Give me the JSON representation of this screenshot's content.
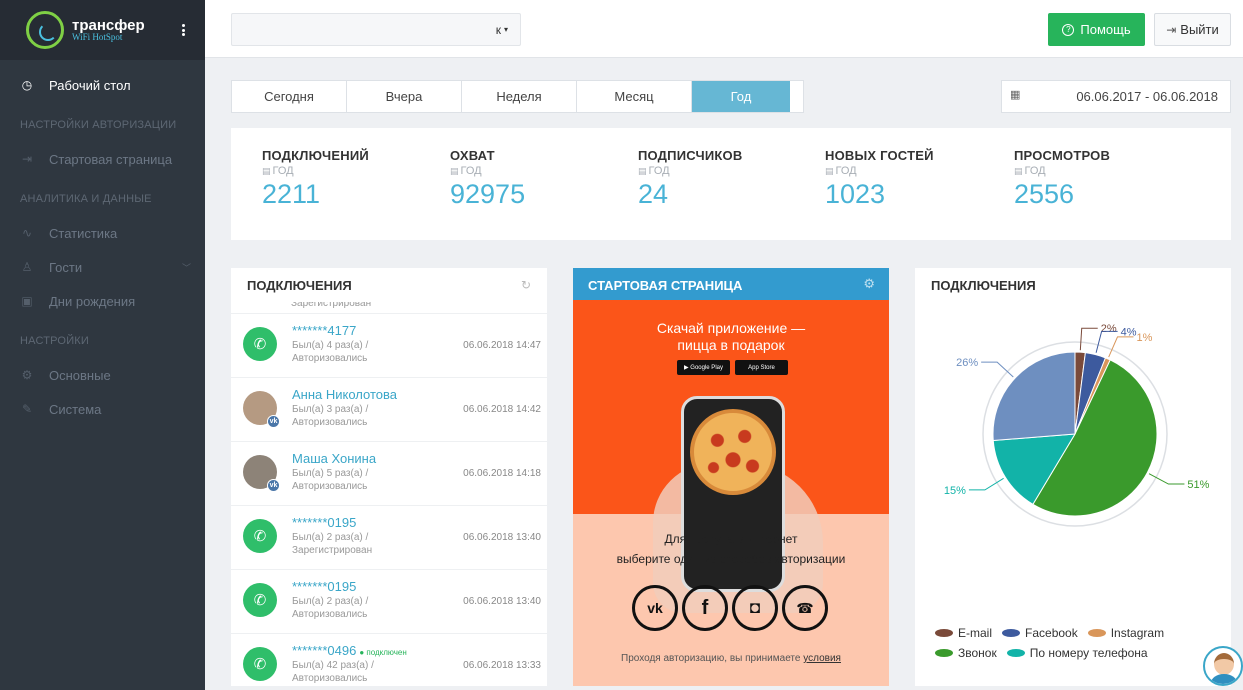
{
  "brand": {
    "title": "трансфер",
    "subtitle": "WiFi HotSpot"
  },
  "sidebar": {
    "dashboard": "Рабочий стол",
    "sections": [
      {
        "label": "НАСТРОЙКИ АВТОРИЗАЦИИ",
        "items": [
          "Стартовая страница"
        ]
      },
      {
        "label": "АНАЛИТИКА И ДАННЫЕ",
        "items": [
          "Статистика",
          "Гости",
          "Дни рождения"
        ]
      },
      {
        "label": "НАСТРОЙКИ",
        "items": [
          "Основные",
          "Система"
        ]
      }
    ]
  },
  "header": {
    "account_value": "к",
    "help_label": "Помощь",
    "logout_label": "Выйти"
  },
  "period_tabs": [
    "Сегодня",
    "Вчера",
    "Неделя",
    "Месяц",
    "Год"
  ],
  "active_period": "Год",
  "date_range": "06.06.2017 - 06.06.2018",
  "stats": [
    {
      "label": "ПОДКЛЮЧЕНИЙ",
      "period": "ГОД",
      "value": "2211"
    },
    {
      "label": "ОХВАТ",
      "period": "ГОД",
      "value": "92975"
    },
    {
      "label": "ПОДПИСЧИКОВ",
      "period": "ГОД",
      "value": "24"
    },
    {
      "label": "НОВЫХ ГОСТЕЙ",
      "period": "ГОД",
      "value": "1023"
    },
    {
      "label": "ПРОСМОТРОВ",
      "period": "ГОД",
      "value": "2556"
    }
  ],
  "connections": {
    "title": "ПОДКЛЮЧЕНИЯ",
    "cut_text": "Зарегистрирован",
    "items": [
      {
        "name": "*******4177",
        "visits": "Был(а) 4 раз(а) /",
        "status": "Авторизовались",
        "date": "06.06.2018 14:47",
        "avatar": "phone",
        "online": ""
      },
      {
        "name": "Анна Николотова",
        "visits": "Был(а) 3 раз(а) /",
        "status": "Авторизовались",
        "date": "06.06.2018 14:42",
        "avatar": "photo",
        "online": ""
      },
      {
        "name": "Маша Хонина",
        "visits": "Был(а) 5 раз(а) /",
        "status": "Авторизовались",
        "date": "06.06.2018 14:18",
        "avatar": "photo2",
        "online": ""
      },
      {
        "name": "*******0195",
        "visits": "Был(а) 2 раз(а) /",
        "status": "Зарегистрирован",
        "date": "06.06.2018 13:40",
        "avatar": "phone",
        "online": ""
      },
      {
        "name": "*******0195",
        "visits": "Был(а) 2 раз(а) /",
        "status": "Авторизовались",
        "date": "06.06.2018 13:40",
        "avatar": "phone",
        "online": ""
      },
      {
        "name": "*******0496",
        "visits": "Был(а) 42 раз(а) /",
        "status": "Авторизовались",
        "date": "06.06.2018 13:33",
        "avatar": "phone",
        "online": "● подключен"
      }
    ]
  },
  "start_page": {
    "title": "СТАРТОВАЯ СТРАНИЦА",
    "promo_line1": "Скачай приложение —",
    "promo_line2": "пицца в подарок",
    "store_google": "Google Play",
    "store_apple": "App Store",
    "access_line1": "Для доступа в интернет",
    "access_line2": "выберите один из способов авторизации",
    "social": [
      "vk",
      "f",
      "ig",
      "ph"
    ],
    "footer_text": "Проходя авторизацию, вы принимаете ",
    "footer_link": "условия"
  },
  "pie_panel": {
    "title": "ПОДКЛЮЧЕНИЯ"
  },
  "chart_data": {
    "type": "pie",
    "title": "ПОДКЛЮЧЕНИЯ",
    "series": [
      {
        "name": "E-mail",
        "value": 2,
        "label": "2%",
        "color": "#7a4a3a"
      },
      {
        "name": "Facebook",
        "value": 4,
        "label": "4%",
        "color": "#3d5a9e"
      },
      {
        "name": "Instagram",
        "value": 1,
        "label": "1%",
        "color": "#d9965a"
      },
      {
        "name": "Звонок",
        "value": 51,
        "label": "51%",
        "color": "#3a9a2c"
      },
      {
        "name": "По номеру телефона",
        "value": 15,
        "label": "15%",
        "color": "#12b3a8"
      },
      {
        "name": "",
        "value": 26,
        "label": "26%",
        "color": "#6e8fc0"
      }
    ],
    "legend_placement": "bottom"
  },
  "colors": {
    "accent_blue": "#49b3d6",
    "help_green": "#27b45b",
    "sidebar_bg": "#2f3740",
    "start_header": "#339bcf",
    "promo_orange": "#fb5519"
  }
}
